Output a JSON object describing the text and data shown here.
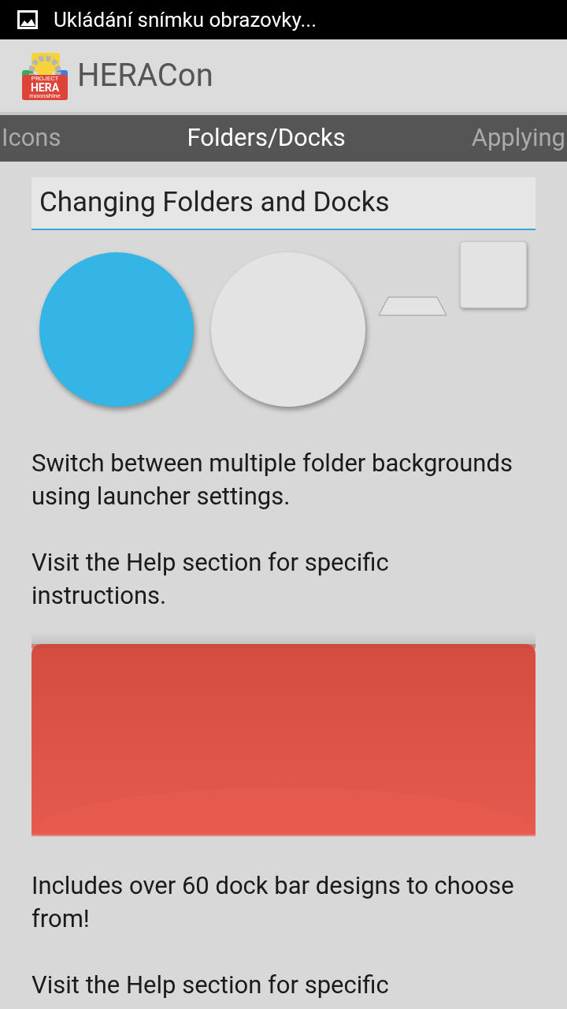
{
  "status_bar": {
    "notification": "Ukládání snímku obrazovky..."
  },
  "app_bar": {
    "logo": {
      "top": "PROJECT",
      "main": "HERA",
      "bottom": "moonshine"
    },
    "title": "HERACon"
  },
  "tabs": [
    {
      "label": "Icons",
      "selected": false
    },
    {
      "label": "Folders/Docks",
      "selected": true
    },
    {
      "label": "Applying",
      "selected": false
    }
  ],
  "heading": "Changing Folders and Docks",
  "shapes": [
    {
      "kind": "circle",
      "color": "#35b4e6"
    },
    {
      "kind": "circle",
      "color": "#e3e3e3"
    },
    {
      "kind": "trapezoid",
      "color": "#e3e3e3"
    },
    {
      "kind": "square",
      "color": "#e3e3e3"
    }
  ],
  "paragraphs_1": [
    "Switch between multiple folder backgrounds using launcher settings.",
    "Visit the Help section for specific instructions."
  ],
  "dock_preview": {
    "kind": "picture"
  },
  "paragraphs_2": [
    "Includes over 60 dock bar designs to choose from!",
    "Visit the Help section for specific"
  ]
}
